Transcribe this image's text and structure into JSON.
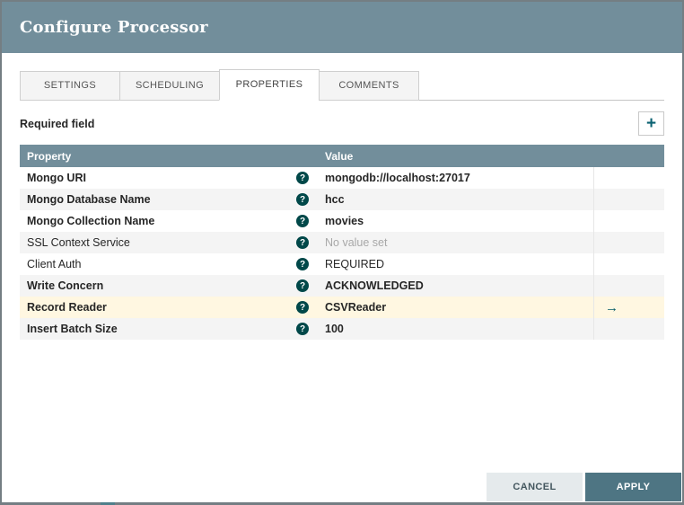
{
  "colors": {
    "accent": "#728E9B",
    "dark_teal": "#004849",
    "highlight_row": "#FFF7E1",
    "apply_button": "#4E7583"
  },
  "icons": {
    "add": "+",
    "help": "?",
    "arrow": "→"
  },
  "dialog": {
    "title": "Configure Processor",
    "tabs": [
      {
        "label": "SETTINGS",
        "active": false
      },
      {
        "label": "SCHEDULING",
        "active": false
      },
      {
        "label": "PROPERTIES",
        "active": true
      },
      {
        "label": "COMMENTS",
        "active": false
      }
    ],
    "required_field_label": "Required field",
    "table": {
      "headers": [
        "Property",
        "Value"
      ],
      "rows": [
        {
          "property": "Mongo URI",
          "value": "mongodb://localhost:27017",
          "required": true,
          "value_set": true,
          "highlighted": false,
          "has_arrow": false
        },
        {
          "property": "Mongo Database Name",
          "value": "hcc",
          "required": true,
          "value_set": true,
          "highlighted": false,
          "has_arrow": false
        },
        {
          "property": "Mongo Collection Name",
          "value": "movies",
          "required": true,
          "value_set": true,
          "highlighted": false,
          "has_arrow": false
        },
        {
          "property": "SSL Context Service",
          "value": "No value set",
          "required": false,
          "value_set": false,
          "highlighted": false,
          "has_arrow": false
        },
        {
          "property": "Client Auth",
          "value": "REQUIRED",
          "required": false,
          "value_set": true,
          "highlighted": false,
          "has_arrow": false
        },
        {
          "property": "Write Concern",
          "value": "ACKNOWLEDGED",
          "required": true,
          "value_set": true,
          "highlighted": false,
          "has_arrow": false
        },
        {
          "property": "Record Reader",
          "value": "CSVReader",
          "required": true,
          "value_set": true,
          "highlighted": true,
          "has_arrow": true
        },
        {
          "property": "Insert Batch Size",
          "value": "100",
          "required": true,
          "value_set": true,
          "highlighted": false,
          "has_arrow": false
        }
      ]
    },
    "buttons": {
      "cancel": "CANCEL",
      "apply": "APPLY"
    }
  }
}
